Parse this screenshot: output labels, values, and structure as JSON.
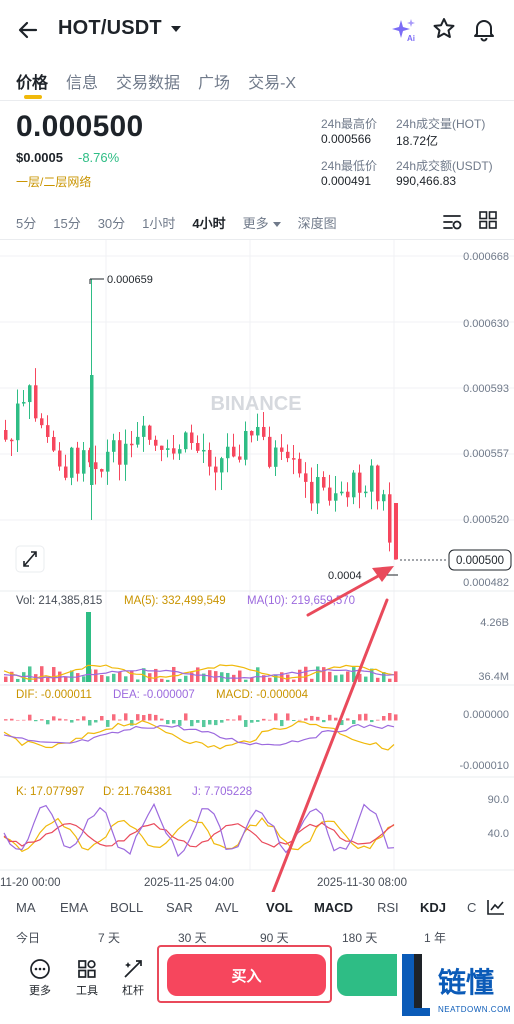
{
  "header": {
    "title": "HOT/USDT",
    "ai_label": "Ai"
  },
  "tabs": [
    "价格",
    "信息",
    "交易数据",
    "广场",
    "交易-X"
  ],
  "price": {
    "last": "0.000500",
    "fiat": "$0.0005",
    "change": "-8.76%",
    "network": "一层/二层网络"
  },
  "stats": {
    "high_label": "24h最高价",
    "high_value": "0.000566",
    "vol_base_label": "24h成交量(HOT)",
    "vol_base_value": "18.72亿",
    "low_label": "24h最低价",
    "low_value": "0.000491",
    "vol_quote_label": "24h成交额(USDT)",
    "vol_quote_value": "990,466.83"
  },
  "intervals": [
    "5分",
    "15分",
    "30分",
    "1小时",
    "4小时",
    "更多",
    "深度图"
  ],
  "chart": {
    "watermark": "BINANCE",
    "price_axis": [
      "0.000668",
      "0.000630",
      "0.000593",
      "0.000557",
      "0.000520",
      "0.000482"
    ],
    "current_price_tag": "0.000500",
    "high_marker": "0.000659",
    "low_marker": "0.0004",
    "vol_text": "Vol: 214,385,815",
    "ma5_text": "MA(5): 332,499,549",
    "ma10_text": "MA(10): 219,659,570",
    "vol_axis_top": "4.26B",
    "vol_axis_bottom": "36.4M",
    "dif_text": "DIF: -0.000011",
    "dea_text": "DEA: -0.000007",
    "macd_text": "MACD: -0.000004",
    "macd_axis_top": "0.000000",
    "macd_axis_bottom": "-0.000010",
    "k_text": "K: 17.077997",
    "d_text": "D: 21.764381",
    "j_text": "J: 7.705228",
    "kdj_axis_top": "90.0",
    "kdj_axis_bottom": "40.0",
    "time_labels": [
      "11-20 00:00",
      "2025-11-25 04:00",
      "2025-11-30 08:00"
    ],
    "colors": {
      "up": "#2ebd85",
      "down": "#f6465d",
      "ma5": "#f0b90b",
      "ma10": "#9c6ade",
      "annotation": "#e94a5b"
    }
  },
  "indicators": [
    "MA",
    "EMA",
    "BOLL",
    "SAR",
    "AVL",
    "VOL",
    "MACD",
    "RSI",
    "KDJ",
    "C"
  ],
  "ranges": [
    "今日",
    "7 天",
    "30 天",
    "90 天",
    "180 天",
    "1 年"
  ],
  "tools": [
    "更多",
    "工具",
    "杠杆"
  ],
  "buy_label": "买入",
  "logo": {
    "brand": "链懂",
    "domain": "NEATDOWN.COM"
  }
}
